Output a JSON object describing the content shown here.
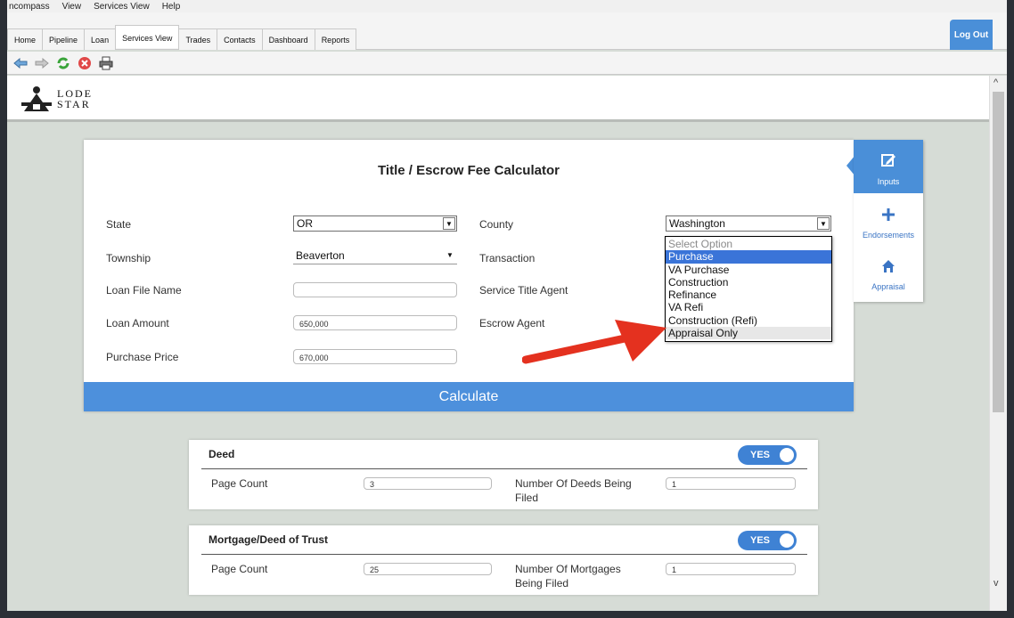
{
  "menubar": {
    "items": [
      "ncompass",
      "View",
      "Services View",
      "Help"
    ]
  },
  "tabs": [
    "Home",
    "Pipeline",
    "Loan",
    "Services View",
    "Trades",
    "Contacts",
    "Dashboard",
    "Reports"
  ],
  "active_tab": "Services View",
  "toolbar": {
    "icons": [
      "back-arrow-icon",
      "forward-arrow-icon",
      "refresh-icon",
      "stop-icon",
      "print-icon"
    ]
  },
  "logo": {
    "text": "LODE\nSTAR"
  },
  "header": {
    "logout_label": "Log Out"
  },
  "calculator": {
    "title": "Title / Escrow Fee Calculator",
    "fields": {
      "state": {
        "label": "State",
        "value": "OR"
      },
      "county": {
        "label": "County",
        "value": "Washington"
      },
      "township": {
        "label": "Township",
        "value": "Beaverton"
      },
      "transaction": {
        "label": "Transaction"
      },
      "loan_file_name": {
        "label": "Loan File Name",
        "value": ""
      },
      "service_title_agent": {
        "label": "Service Title Agent"
      },
      "loan_amount": {
        "label": "Loan Amount",
        "value": "650,000"
      },
      "escrow_agent": {
        "label": "Escrow Agent"
      },
      "purchase_price": {
        "label": "Purchase Price",
        "value": "670,000"
      }
    },
    "calculate_label": "Calculate"
  },
  "transaction_dropdown": {
    "options": [
      "Select Option",
      "Purchase",
      "VA Purchase",
      "Construction",
      "Refinance",
      "VA Refi",
      "Construction (Refi)",
      "Appraisal Only"
    ],
    "selected": "Purchase",
    "hovered": "Appraisal Only"
  },
  "side_tabs": [
    {
      "label": "Inputs",
      "icon": "edit-icon",
      "active": true
    },
    {
      "label": "Endorsements",
      "icon": "plus-icon",
      "active": false
    },
    {
      "label": "Appraisal",
      "icon": "home-icon",
      "active": false
    }
  ],
  "sections": {
    "deed": {
      "title": "Deed",
      "toggle": "YES",
      "page_count_label": "Page Count",
      "page_count": "3",
      "count_label": "Number Of Deeds Being Filed",
      "count": "1"
    },
    "mortgage": {
      "title": "Mortgage/Deed of Trust",
      "toggle": "YES",
      "page_count_label": "Page Count",
      "page_count": "25",
      "count_label": "Number Of Mortgages Being Filed",
      "count": "1"
    }
  },
  "colors": {
    "accent": "#4a8fd8",
    "annotation_arrow": "#e4311f"
  }
}
